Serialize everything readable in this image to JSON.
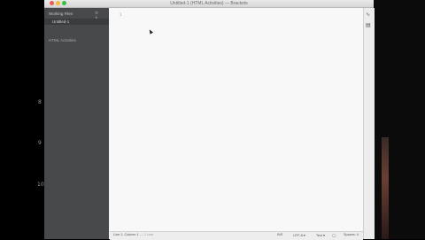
{
  "window": {
    "title": "Untitled-1 (HTML Activities) — Brackets"
  },
  "sidebar": {
    "working_files_label": "Working Files",
    "working_files_icons": "⚙ ⇅",
    "open_file": "Untitled-1",
    "project_label": "HTML Activities"
  },
  "editor": {
    "line_number": "1"
  },
  "left_markers": [
    "8",
    "9",
    "10"
  ],
  "toolbar": {
    "live_preview_glyph": "∿",
    "extension_glyph": "▤"
  },
  "statusbar": {
    "cursor_position": "Line 1, Column 1",
    "line_count": "— 1 Line",
    "ins": "INS",
    "encoding": "UTF-8 ▾",
    "language": "Text ▾",
    "spaces": "Spaces: 4"
  }
}
